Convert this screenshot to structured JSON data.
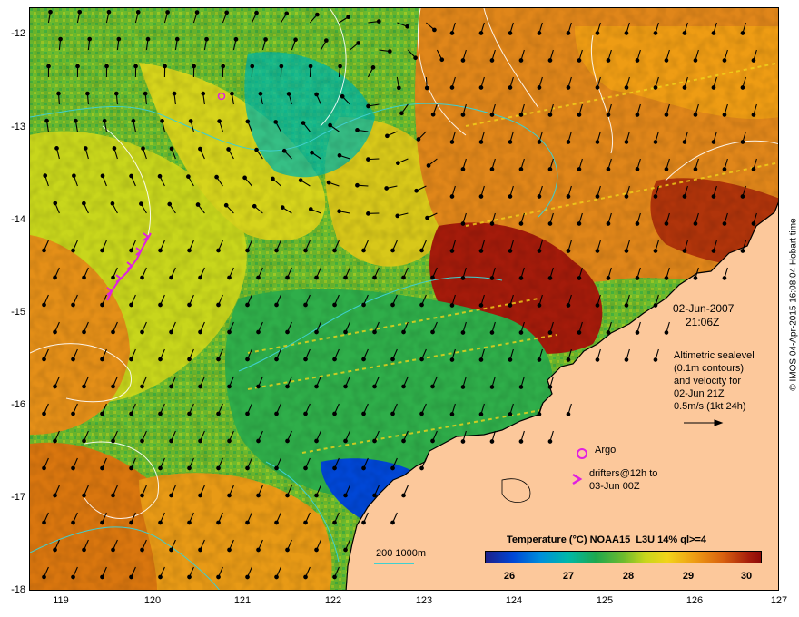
{
  "map": {
    "lon_ticks": [
      "119",
      "120",
      "121",
      "122",
      "123",
      "124",
      "125",
      "126",
      "127"
    ],
    "lat_ticks": [
      "-12",
      "-13",
      "-14",
      "-15",
      "-16",
      "-17",
      "-18"
    ],
    "lon_range": [
      118.6,
      127.0
    ],
    "lat_range": [
      -18.0,
      -11.7
    ],
    "date_line1": "02-Jun-2007",
    "date_line2": "21:06Z",
    "altimetry_text": [
      "Altimetric sealevel",
      "(0.1m contours)",
      "and velocity for",
      "02-Jun 21Z",
      "0.5m/s (1kt 24h)"
    ],
    "argo_label": "Argo",
    "drifters_text": [
      "drifters@12h to",
      "03-Jun 00Z"
    ],
    "colorbar_title": "Temperature (°C) NOAA15_L3U 14% ql>=4",
    "colorbar_ticks": [
      "26",
      "27",
      "28",
      "29",
      "30"
    ],
    "bathymetry_label": "200  1000m",
    "credit": "© IMOS 04-Apr-2015 16:08:04 Hobart time",
    "colors": {
      "land": "#fcc89b",
      "sst_cold": "#0047d6",
      "sst_mid": "#6dbb2e",
      "sst_warm": "#ee9c14",
      "sst_hot": "#8d0b09",
      "contour": "#ffffff",
      "bathymetry": "#3fd0d0",
      "argo_marker": "#e020e0",
      "drifter_marker": "#e020e0",
      "vectors": "#000000"
    }
  }
}
